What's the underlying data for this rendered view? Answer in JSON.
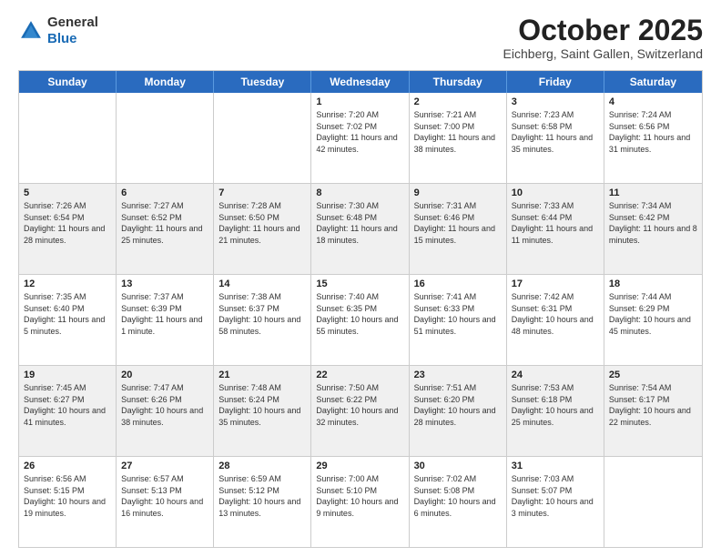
{
  "header": {
    "logo_general": "General",
    "logo_blue": "Blue",
    "month_title": "October 2025",
    "location": "Eichberg, Saint Gallen, Switzerland"
  },
  "days_of_week": [
    "Sunday",
    "Monday",
    "Tuesday",
    "Wednesday",
    "Thursday",
    "Friday",
    "Saturday"
  ],
  "weeks": [
    [
      {
        "num": "",
        "info": ""
      },
      {
        "num": "",
        "info": ""
      },
      {
        "num": "",
        "info": ""
      },
      {
        "num": "1",
        "info": "Sunrise: 7:20 AM\nSunset: 7:02 PM\nDaylight: 11 hours and 42 minutes."
      },
      {
        "num": "2",
        "info": "Sunrise: 7:21 AM\nSunset: 7:00 PM\nDaylight: 11 hours and 38 minutes."
      },
      {
        "num": "3",
        "info": "Sunrise: 7:23 AM\nSunset: 6:58 PM\nDaylight: 11 hours and 35 minutes."
      },
      {
        "num": "4",
        "info": "Sunrise: 7:24 AM\nSunset: 6:56 PM\nDaylight: 11 hours and 31 minutes."
      }
    ],
    [
      {
        "num": "5",
        "info": "Sunrise: 7:26 AM\nSunset: 6:54 PM\nDaylight: 11 hours and 28 minutes."
      },
      {
        "num": "6",
        "info": "Sunrise: 7:27 AM\nSunset: 6:52 PM\nDaylight: 11 hours and 25 minutes."
      },
      {
        "num": "7",
        "info": "Sunrise: 7:28 AM\nSunset: 6:50 PM\nDaylight: 11 hours and 21 minutes."
      },
      {
        "num": "8",
        "info": "Sunrise: 7:30 AM\nSunset: 6:48 PM\nDaylight: 11 hours and 18 minutes."
      },
      {
        "num": "9",
        "info": "Sunrise: 7:31 AM\nSunset: 6:46 PM\nDaylight: 11 hours and 15 minutes."
      },
      {
        "num": "10",
        "info": "Sunrise: 7:33 AM\nSunset: 6:44 PM\nDaylight: 11 hours and 11 minutes."
      },
      {
        "num": "11",
        "info": "Sunrise: 7:34 AM\nSunset: 6:42 PM\nDaylight: 11 hours and 8 minutes."
      }
    ],
    [
      {
        "num": "12",
        "info": "Sunrise: 7:35 AM\nSunset: 6:40 PM\nDaylight: 11 hours and 5 minutes."
      },
      {
        "num": "13",
        "info": "Sunrise: 7:37 AM\nSunset: 6:39 PM\nDaylight: 11 hours and 1 minute."
      },
      {
        "num": "14",
        "info": "Sunrise: 7:38 AM\nSunset: 6:37 PM\nDaylight: 10 hours and 58 minutes."
      },
      {
        "num": "15",
        "info": "Sunrise: 7:40 AM\nSunset: 6:35 PM\nDaylight: 10 hours and 55 minutes."
      },
      {
        "num": "16",
        "info": "Sunrise: 7:41 AM\nSunset: 6:33 PM\nDaylight: 10 hours and 51 minutes."
      },
      {
        "num": "17",
        "info": "Sunrise: 7:42 AM\nSunset: 6:31 PM\nDaylight: 10 hours and 48 minutes."
      },
      {
        "num": "18",
        "info": "Sunrise: 7:44 AM\nSunset: 6:29 PM\nDaylight: 10 hours and 45 minutes."
      }
    ],
    [
      {
        "num": "19",
        "info": "Sunrise: 7:45 AM\nSunset: 6:27 PM\nDaylight: 10 hours and 41 minutes."
      },
      {
        "num": "20",
        "info": "Sunrise: 7:47 AM\nSunset: 6:26 PM\nDaylight: 10 hours and 38 minutes."
      },
      {
        "num": "21",
        "info": "Sunrise: 7:48 AM\nSunset: 6:24 PM\nDaylight: 10 hours and 35 minutes."
      },
      {
        "num": "22",
        "info": "Sunrise: 7:50 AM\nSunset: 6:22 PM\nDaylight: 10 hours and 32 minutes."
      },
      {
        "num": "23",
        "info": "Sunrise: 7:51 AM\nSunset: 6:20 PM\nDaylight: 10 hours and 28 minutes."
      },
      {
        "num": "24",
        "info": "Sunrise: 7:53 AM\nSunset: 6:18 PM\nDaylight: 10 hours and 25 minutes."
      },
      {
        "num": "25",
        "info": "Sunrise: 7:54 AM\nSunset: 6:17 PM\nDaylight: 10 hours and 22 minutes."
      }
    ],
    [
      {
        "num": "26",
        "info": "Sunrise: 6:56 AM\nSunset: 5:15 PM\nDaylight: 10 hours and 19 minutes."
      },
      {
        "num": "27",
        "info": "Sunrise: 6:57 AM\nSunset: 5:13 PM\nDaylight: 10 hours and 16 minutes."
      },
      {
        "num": "28",
        "info": "Sunrise: 6:59 AM\nSunset: 5:12 PM\nDaylight: 10 hours and 13 minutes."
      },
      {
        "num": "29",
        "info": "Sunrise: 7:00 AM\nSunset: 5:10 PM\nDaylight: 10 hours and 9 minutes."
      },
      {
        "num": "30",
        "info": "Sunrise: 7:02 AM\nSunset: 5:08 PM\nDaylight: 10 hours and 6 minutes."
      },
      {
        "num": "31",
        "info": "Sunrise: 7:03 AM\nSunset: 5:07 PM\nDaylight: 10 hours and 3 minutes."
      },
      {
        "num": "",
        "info": ""
      }
    ]
  ]
}
